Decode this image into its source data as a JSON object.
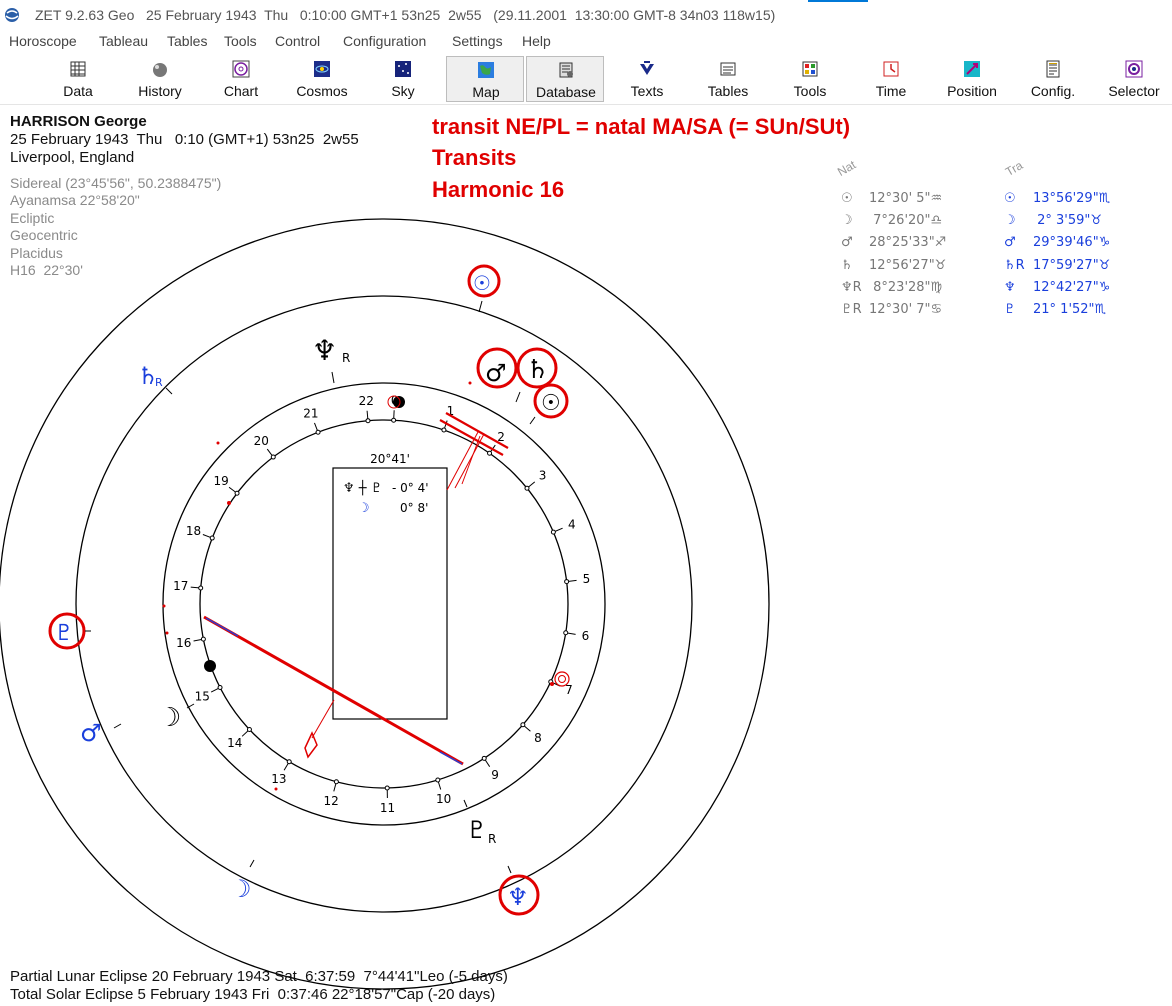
{
  "window": {
    "title": "ZET 9.2.63 Geo   25 February 1943  Thu   0:10:00 GMT+1 53n25  2w55   (29.11.2001  13:30:00 GMT-8 34n03 118w15)"
  },
  "menu": [
    "Horoscope",
    "Tableau",
    "Tables",
    "Tools",
    "Control",
    "Configuration",
    "Settings",
    "Help"
  ],
  "toolbar": {
    "buttons": [
      {
        "label": "Data",
        "icon": "data-grid-icon"
      },
      {
        "label": "History",
        "icon": "history-ball-icon"
      },
      {
        "label": "Chart",
        "icon": "chart-wheel-icon"
      },
      {
        "label": "Cosmos",
        "icon": "cosmos-icon"
      },
      {
        "label": "Sky",
        "icon": "sky-icon"
      },
      {
        "label": "Map",
        "icon": "map-icon"
      },
      {
        "label": "Database",
        "icon": "database-icon"
      },
      {
        "label": "Texts",
        "icon": "texts-icon"
      },
      {
        "label": "Tables",
        "icon": "tables-icon"
      },
      {
        "label": "Tools",
        "icon": "tools-icon"
      },
      {
        "label": "Time",
        "icon": "time-icon"
      },
      {
        "label": "Position",
        "icon": "position-icon"
      },
      {
        "label": "Config.",
        "icon": "config-icon"
      },
      {
        "label": "Selector",
        "icon": "selector-icon"
      }
    ],
    "pressed": [
      "Map",
      "Database"
    ]
  },
  "person": {
    "name": "HARRISON George",
    "line1": "25 February 1943  Thu   0:10 (GMT+1) 53n25  2w55",
    "line2": "Liverpool, England"
  },
  "settings": [
    "Sidereal (23°45'56\", 50.2388475\")",
    "Ayanamsa 22°58'20\"",
    "Ecliptic",
    "Geocentric",
    "Placidus",
    "H16  22°30'"
  ],
  "headline": [
    "transit NE/PL = natal MA/SA (= SUn/SUt)",
    "Transits",
    "Harmonic 16"
  ],
  "positions": {
    "nat_header": "Nat",
    "tra_header": "Tra",
    "rows": [
      {
        "nat_glyph": "☉",
        "nat": "12°30' 5\"♒",
        "tra_glyph": "☉",
        "tra": "13°56'29\"♏"
      },
      {
        "nat_glyph": "☽",
        "nat": " 7°26'20\"♎",
        "tra_glyph": "☽",
        "tra": " 2° 3'59\"♉"
      },
      {
        "nat_glyph": "♂",
        "nat": "28°25'33\"♐",
        "tra_glyph": "♂",
        "tra": "29°39'46\"♑"
      },
      {
        "nat_glyph": "♄",
        "nat": "12°56'27\"♉",
        "tra_glyph": "♄R",
        "tra": "17°59'27\"♉"
      },
      {
        "nat_glyph": "♆R",
        "nat": " 8°23'28\"♍",
        "tra_glyph": "♆",
        "tra": "12°42'27\"♑"
      },
      {
        "nat_glyph": "♇R",
        "nat": "12°30' 7\"♋",
        "tra_glyph": "♇",
        "tra": "21° 1'52\"♏"
      }
    ]
  },
  "dial": {
    "numbers": [
      "0",
      "1",
      "2",
      "3",
      "4",
      "5",
      "6",
      "7",
      "8",
      "9",
      "10",
      "11",
      "12",
      "13",
      "14",
      "15",
      "16",
      "17",
      "18",
      "19",
      "20",
      "21",
      "22"
    ],
    "box_title": "20°41'",
    "box_row1_glyphs": "♆ ┼ ♇",
    "box_row1_value": "- 0° 4'",
    "box_row2_glyph": "☽",
    "box_row2_value": "0° 8'",
    "natal_planets": [
      {
        "glyph": "♆",
        "suffix": "R",
        "color": "#000"
      },
      {
        "glyph": "♂",
        "suffix": "",
        "color": "#000"
      },
      {
        "glyph": "♄",
        "suffix": "",
        "color": "#000"
      },
      {
        "glyph": "☉",
        "suffix": "",
        "color": "#000"
      },
      {
        "glyph": "☽",
        "suffix": "",
        "color": "#000"
      },
      {
        "glyph": "♇",
        "suffix": "R",
        "color": "#000"
      }
    ],
    "transit_planets": [
      {
        "glyph": "☉",
        "suffix": "",
        "color": "#1a3fdc"
      },
      {
        "glyph": "♄",
        "suffix": "R",
        "color": "#1a3fdc"
      },
      {
        "glyph": "♇",
        "suffix": "",
        "color": "#1a3fdc"
      },
      {
        "glyph": "♂",
        "suffix": "",
        "color": "#1a3fdc"
      },
      {
        "glyph": "☽",
        "suffix": "",
        "color": "#1a3fdc"
      },
      {
        "glyph": "♆",
        "suffix": "",
        "color": "#1a3fdc"
      }
    ],
    "highlight_color": "#e00000"
  },
  "eclipses": [
    "Partial Lunar Eclipse 20 February 1943 Sat  6:37:59  7°44'41\"Leo (-5 days)",
    "Total Solar Eclipse 5 February 1943 Fri  0:37:46 22°18'57\"Cap (-20 days)"
  ]
}
